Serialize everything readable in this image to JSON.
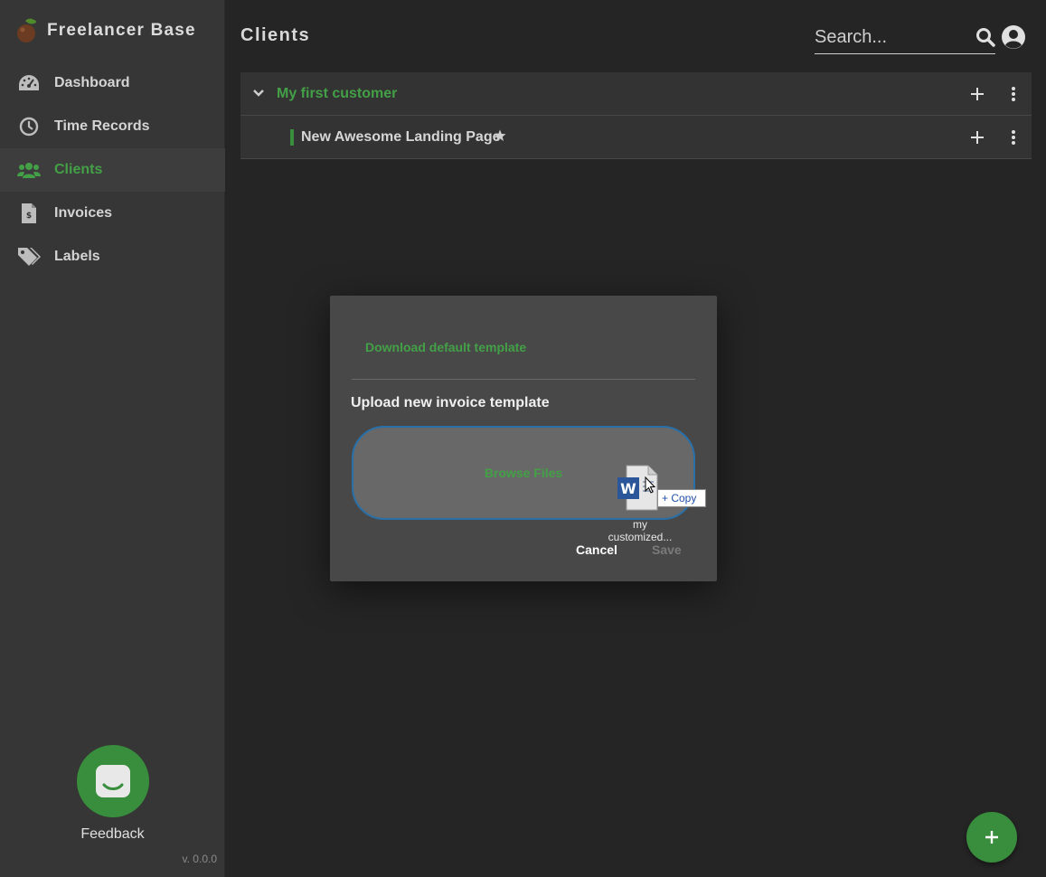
{
  "app": {
    "title": "Freelancer Base",
    "version": "v. 0.0.0"
  },
  "sidebar": {
    "items": [
      {
        "label": "Dashboard",
        "icon": "gauge-icon",
        "active": false
      },
      {
        "label": "Time Records",
        "icon": "clock-icon",
        "active": false
      },
      {
        "label": "Clients",
        "icon": "users-icon",
        "active": true
      },
      {
        "label": "Invoices",
        "icon": "invoice-icon",
        "active": false
      },
      {
        "label": "Labels",
        "icon": "tags-icon",
        "active": false
      }
    ],
    "feedback_label": "Feedback"
  },
  "header": {
    "title": "Clients",
    "search_placeholder": "Search..."
  },
  "clients": [
    {
      "name": "My first customer",
      "expanded": true,
      "projects": [
        {
          "name": "New Awesome Landing Page",
          "starred": true
        }
      ]
    }
  ],
  "dialog": {
    "download_link": "Download default template",
    "upload_title": "Upload new invoice template",
    "browse_label": "Browse Files",
    "drag_file_label": "my customized...",
    "copy_tag": "+ Copy",
    "cancel_label": "Cancel",
    "save_label": "Save"
  },
  "fab": {
    "label": "+"
  },
  "colors": {
    "accent": "#43a047",
    "sidebar_bg": "#363636",
    "main_bg": "#252525",
    "dialog_bg": "#484848"
  }
}
